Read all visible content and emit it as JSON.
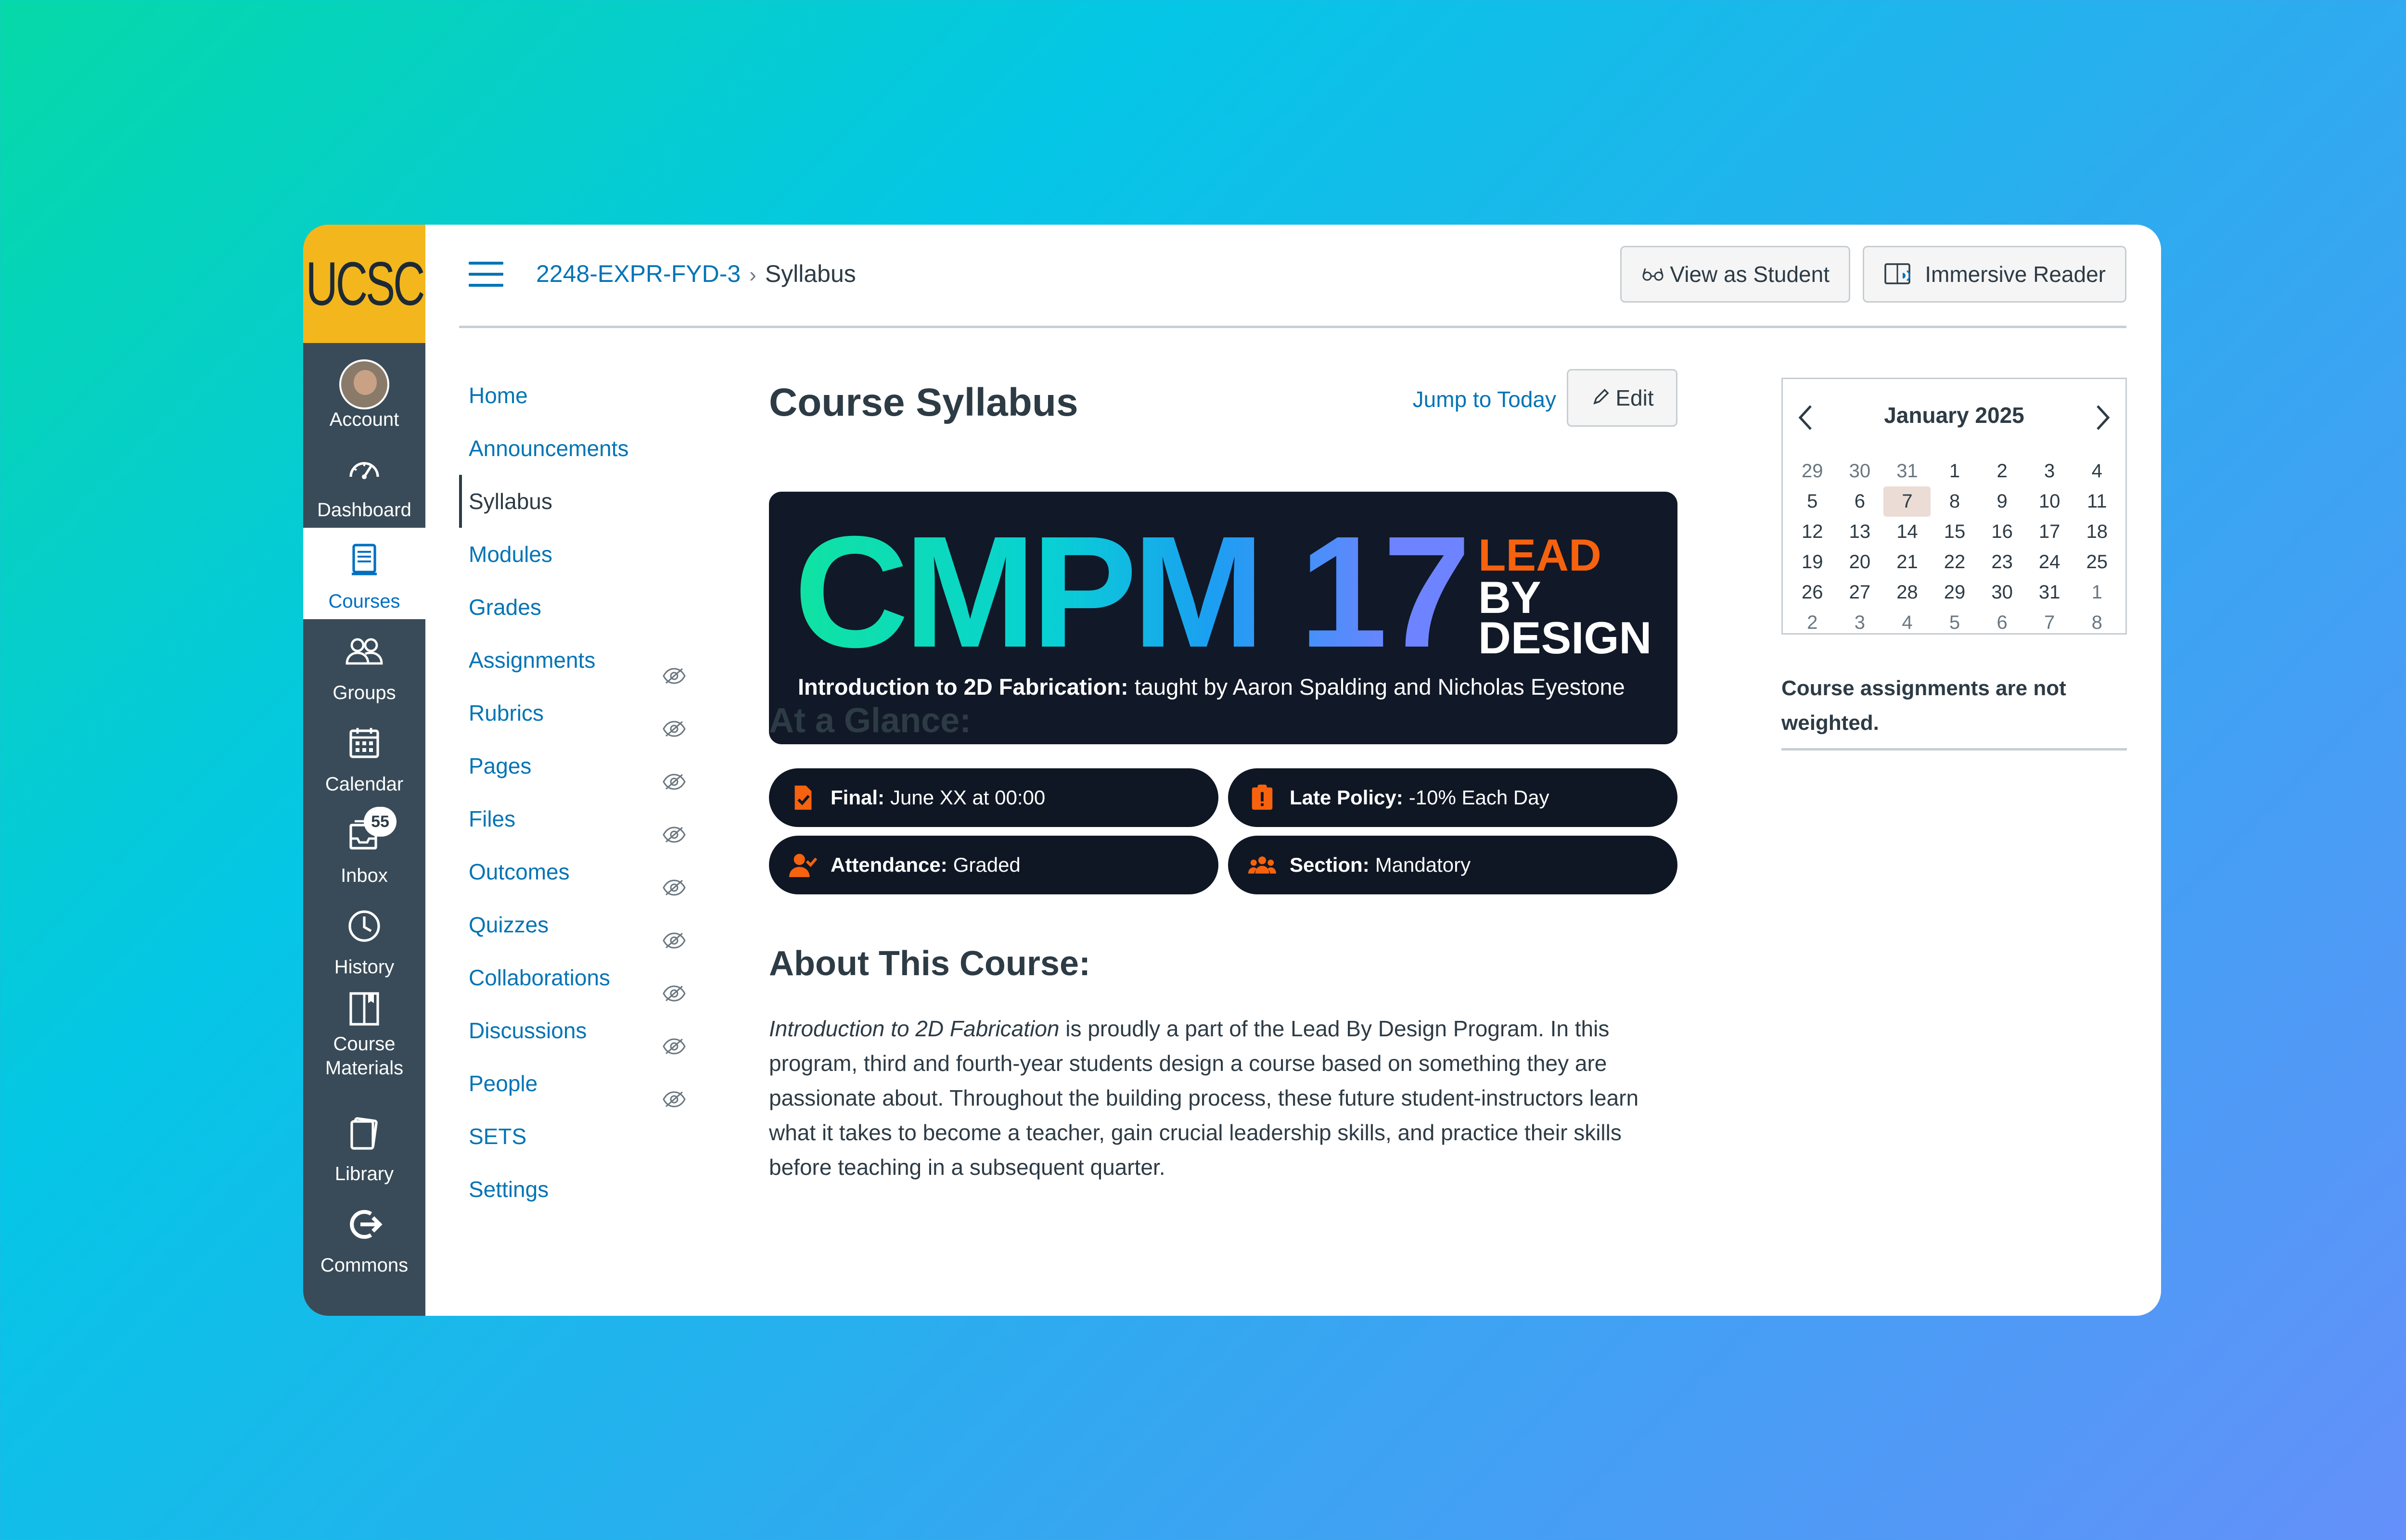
{
  "global_nav": {
    "logo": "UCSC",
    "items": [
      {
        "label": "Account",
        "icon": "avatar"
      },
      {
        "label": "Dashboard",
        "icon": "dashboard-icon"
      },
      {
        "label": "Courses",
        "icon": "courses-icon"
      },
      {
        "label": "Groups",
        "icon": "groups-icon"
      },
      {
        "label": "Calendar",
        "icon": "calendar-icon"
      },
      {
        "label": "Inbox",
        "icon": "inbox-icon",
        "badge": "55"
      },
      {
        "label": "History",
        "icon": "history-icon"
      },
      {
        "label": "Course Materials",
        "icon": "course-materials-icon"
      },
      {
        "label": "Library",
        "icon": "library-icon"
      },
      {
        "label": "Commons",
        "icon": "commons-icon"
      }
    ],
    "active": "Courses"
  },
  "breadcrumb": {
    "course": "2248-EXPR-FYD-3",
    "separator": "›",
    "page": "Syllabus"
  },
  "header_buttons": {
    "view_as_student": "View as Student",
    "immersive_reader": "Immersive Reader"
  },
  "course_nav": [
    {
      "label": "Home",
      "hidden": false
    },
    {
      "label": "Announcements",
      "hidden": false
    },
    {
      "label": "Syllabus",
      "hidden": false,
      "current": true
    },
    {
      "label": "Modules",
      "hidden": false
    },
    {
      "label": "Grades",
      "hidden": false
    },
    {
      "label": "Assignments",
      "hidden": true
    },
    {
      "label": "Rubrics",
      "hidden": true
    },
    {
      "label": "Pages",
      "hidden": true
    },
    {
      "label": "Files",
      "hidden": true
    },
    {
      "label": "Outcomes",
      "hidden": true
    },
    {
      "label": "Quizzes",
      "hidden": true
    },
    {
      "label": "Collaborations",
      "hidden": true
    },
    {
      "label": "Discussions",
      "hidden": true
    },
    {
      "label": "People",
      "hidden": true
    },
    {
      "label": "SETS",
      "hidden": false
    },
    {
      "label": "Settings",
      "hidden": false
    }
  ],
  "main": {
    "title": "Course Syllabus",
    "jump_to_today": "Jump to Today",
    "edit": "Edit",
    "banner": {
      "course_code": "CMPM 17",
      "lead": "LEAD",
      "by_design": "BY DESIGN",
      "subtitle_bold": "Introduction to 2D Fabrication:",
      "subtitle_rest": "taught by Aaron Spalding and Nicholas Eyestone"
    },
    "at_a_glance": {
      "heading": "At a Glance:",
      "items": [
        {
          "label": "Final:",
          "value": "June XX at 00:00",
          "icon": "file-check-icon"
        },
        {
          "label": "Late Policy:",
          "value": "-10% Each Day",
          "icon": "clipboard-alert-icon"
        },
        {
          "label": "Attendance:",
          "value": "Graded",
          "icon": "user-check-icon"
        },
        {
          "label": "Section:",
          "value": "Mandatory",
          "icon": "people-group-icon"
        }
      ]
    },
    "about": {
      "heading": "About This Course:",
      "italic": "Introduction to 2D Fabrication",
      "text": " is proudly a part of the Lead By Design Program. In this program, third and fourth-year students design a course based on something they are passionate about. Throughout the building process, these future student-instructors learn what it takes to become a teacher, gain crucial leadership skills, and practice their skills before teaching in a subsequent quarter."
    }
  },
  "calendar": {
    "month": "January 2025",
    "today": "7",
    "weeks": [
      [
        {
          "d": "29",
          "o": 1
        },
        {
          "d": "30",
          "o": 1
        },
        {
          "d": "31",
          "o": 1
        },
        {
          "d": "1"
        },
        {
          "d": "2"
        },
        {
          "d": "3"
        },
        {
          "d": "4"
        }
      ],
      [
        {
          "d": "5"
        },
        {
          "d": "6"
        },
        {
          "d": "7",
          "t": 1
        },
        {
          "d": "8"
        },
        {
          "d": "9"
        },
        {
          "d": "10"
        },
        {
          "d": "11"
        }
      ],
      [
        {
          "d": "12"
        },
        {
          "d": "13"
        },
        {
          "d": "14"
        },
        {
          "d": "15"
        },
        {
          "d": "16"
        },
        {
          "d": "17"
        },
        {
          "d": "18"
        }
      ],
      [
        {
          "d": "19"
        },
        {
          "d": "20"
        },
        {
          "d": "21"
        },
        {
          "d": "22"
        },
        {
          "d": "23"
        },
        {
          "d": "24"
        },
        {
          "d": "25"
        }
      ],
      [
        {
          "d": "26"
        },
        {
          "d": "27"
        },
        {
          "d": "28"
        },
        {
          "d": "29"
        },
        {
          "d": "30"
        },
        {
          "d": "31"
        },
        {
          "d": "1",
          "o": 1
        }
      ],
      [
        {
          "d": "2",
          "o": 1
        },
        {
          "d": "3",
          "o": 1
        },
        {
          "d": "4",
          "o": 1
        },
        {
          "d": "5",
          "o": 1
        },
        {
          "d": "6",
          "o": 1
        },
        {
          "d": "7",
          "o": 1
        },
        {
          "d": "8",
          "o": 1
        }
      ]
    ]
  },
  "sidebar_note": "Course assignments are not weighted.",
  "colors": {
    "link": "#0374b5",
    "nav_bg": "#394b58",
    "logo_bg": "#f3b71d",
    "accent_orange": "#f7620e",
    "banner_bg": "#111827"
  }
}
